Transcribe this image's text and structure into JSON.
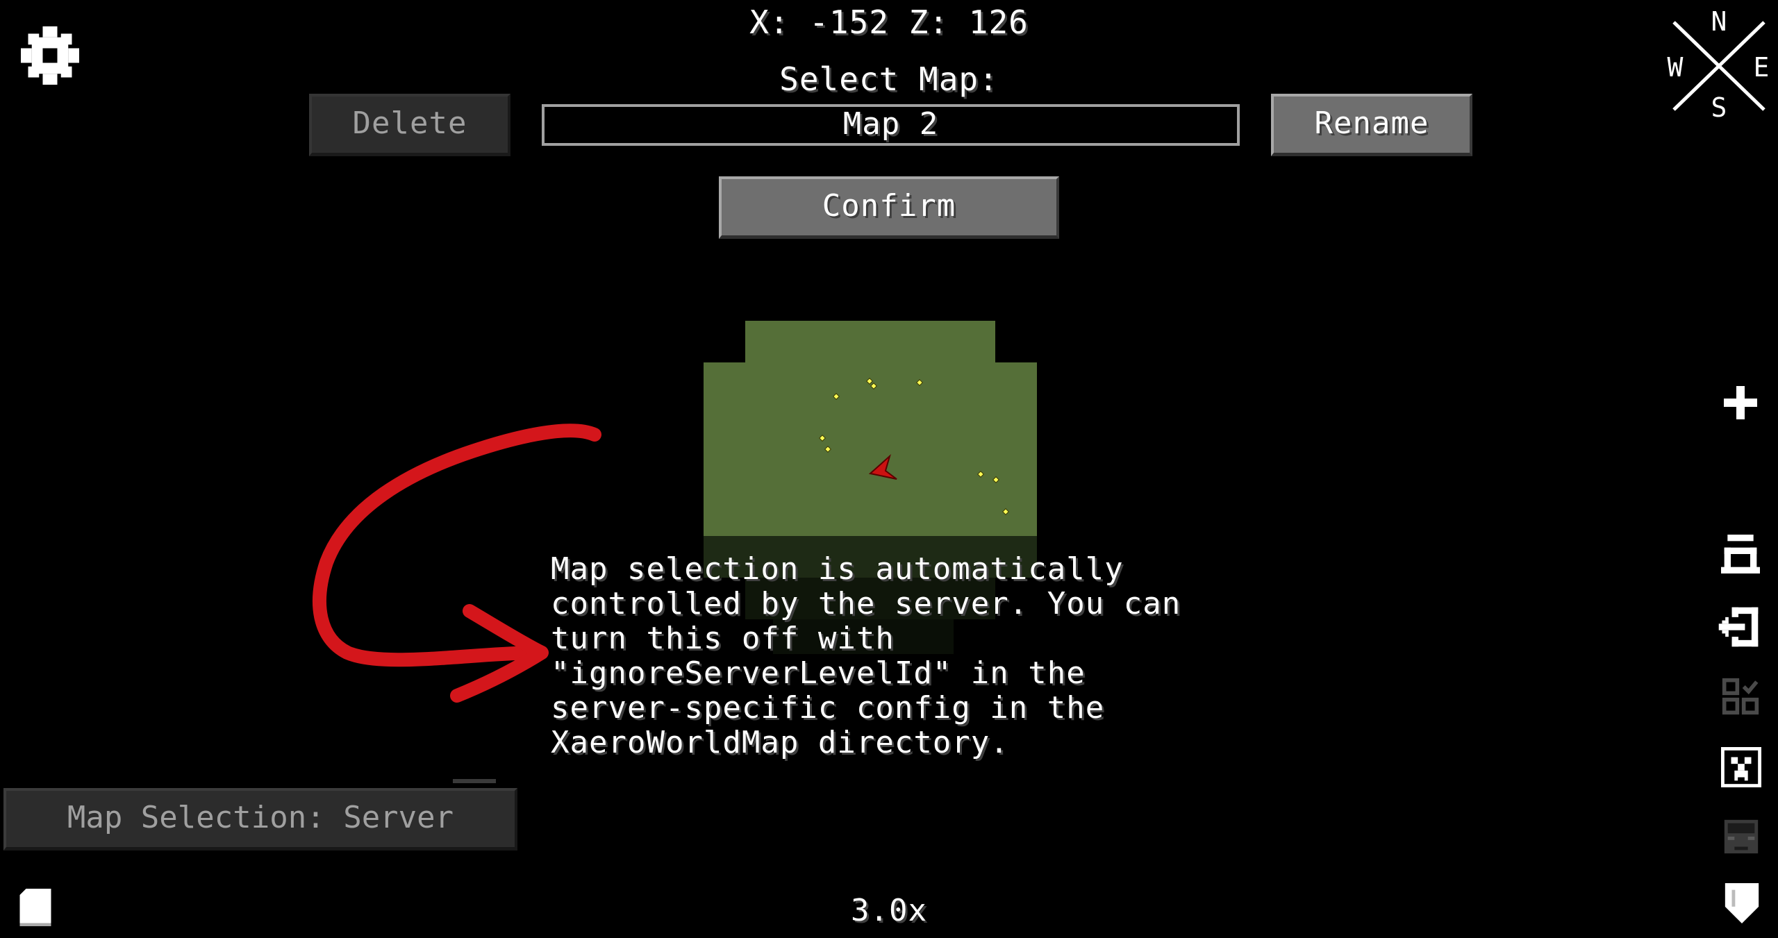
{
  "header": {
    "coordinates": "X: -152 Z: 126",
    "select_map_label": "Select Map:"
  },
  "buttons": {
    "delete_label": "Delete",
    "rename_label": "Rename",
    "confirm_label": "Confirm"
  },
  "map_selector": {
    "value": "Map 2"
  },
  "info": {
    "lines": [
      "Map selection is automatically",
      "controlled by the server. You can",
      "turn this off with",
      "\"ignoreServerLevelId\" in the",
      "server-specific config in the",
      "XaeroWorldMap directory."
    ]
  },
  "map_selection_mode": {
    "label": "Map Selection: Server"
  },
  "footer": {
    "zoom": "3.0x"
  },
  "compass": {
    "north": "N",
    "south": "S",
    "east": "E",
    "west": "W"
  },
  "colors": {
    "background": "#000000",
    "map_terrain": "#556f38",
    "map_dim": "#1e2a15",
    "player_marker": "#cc1111",
    "annotation_arrow": "#d4161b",
    "waypoint_dot": "#ffff55"
  },
  "icons": {
    "settings": "gear-icon",
    "compass": "compass-icon",
    "zoom_in": "plus-icon",
    "cave_mode": "cave-mode-icon",
    "export": "export-icon",
    "grid": "grid-icon",
    "waypoints": "waypoint-icon",
    "players": "player-icon",
    "claims": "shield-icon",
    "notes": "paper-icon"
  }
}
